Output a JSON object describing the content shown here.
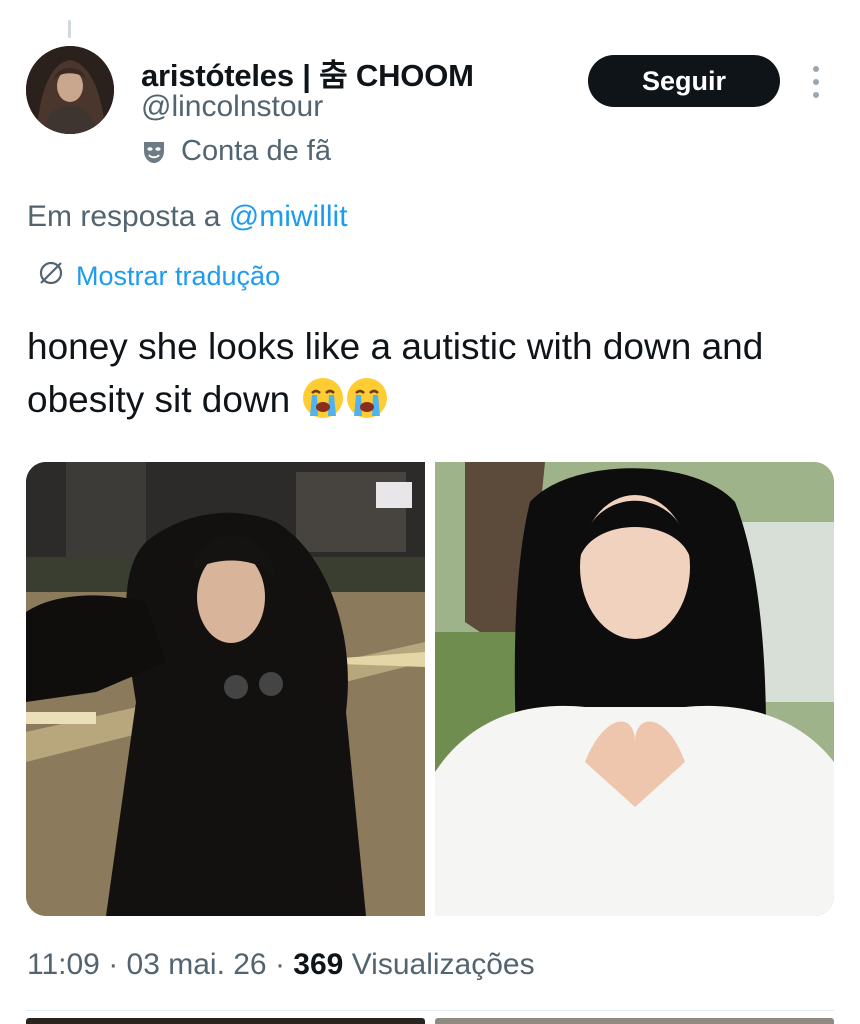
{
  "author": {
    "display_name": "aristóteles | 춤 CHOOM",
    "handle": "@lincolnstour",
    "label": "Conta de fã"
  },
  "follow_button": "Seguir",
  "reply": {
    "prefix": "Em resposta a ",
    "mention": "@miwillit"
  },
  "translate_label": "Mostrar tradução",
  "tweet": {
    "text": "honey she looks like a autistic with down and obesity sit down",
    "emojis": [
      "loudly-crying-face",
      "loudly-crying-face"
    ]
  },
  "media": [
    {
      "description_icon": "photo-woman-night-street"
    },
    {
      "description_icon": "photo-woman-heart-hands"
    }
  ],
  "meta": {
    "time": "11:09",
    "date": "03 mai. 26",
    "views_count": "369",
    "views_label": "Visualizações"
  },
  "colors": {
    "accent": "#1d9bf0",
    "text_primary": "#0f1419",
    "text_secondary": "#536471",
    "button_bg": "#0f1419"
  }
}
